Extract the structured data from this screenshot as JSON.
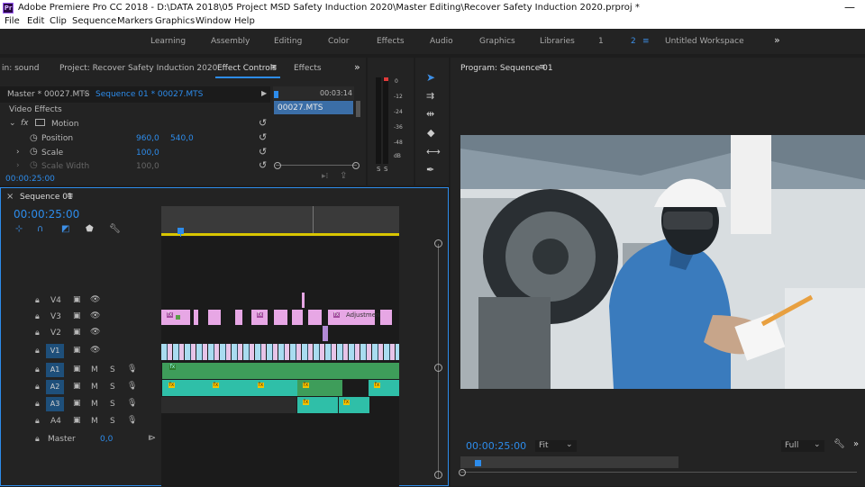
{
  "app": {
    "title": "Adobe Premiere Pro CC 2018 - D:\\DATA 2018\\05 Project MSD Safety Induction 2020\\Master Editing\\Recover Safety Induction 2020.prproj *",
    "icon_label": "Pr",
    "minimize": "—"
  },
  "menu": [
    "File",
    "Edit",
    "Clip",
    "Sequence",
    "Markers",
    "Graphics",
    "Window",
    "Help"
  ],
  "workspaces": {
    "items": [
      "Learning",
      "Assembly",
      "Editing",
      "Color",
      "Effects",
      "Audio",
      "Graphics",
      "Libraries",
      "1",
      "2",
      "Untitled Workspace"
    ],
    "active_index": 9,
    "more": "»"
  },
  "source_panel": {
    "tabs": [
      "in: sound",
      "Project: Recover Safety Induction 2020",
      "Effect Controls",
      "Effects"
    ],
    "active_tab": "Effect Controls",
    "master_clip": "Master * 00027.MTS",
    "sequence_clip": "Sequence 01 * 00027.MTS",
    "ruler_time": "00:03:14",
    "clip_name": "00027.MTS",
    "video_effects_label": "Video Effects",
    "motion_label": "Motion",
    "fx_label": "fx",
    "properties": [
      {
        "name": "Position",
        "v1": "960,0",
        "v2": "540,0"
      },
      {
        "name": "Scale",
        "v1": "100,0",
        "v2": ""
      },
      {
        "name": "Scale Width",
        "v1": "100,0",
        "v2": ""
      }
    ],
    "timecode": "00:00:25:00"
  },
  "audio_meter": {
    "scale": [
      "0",
      "-12",
      "-24",
      "-36",
      "-48",
      "dB"
    ],
    "solo": [
      "S",
      "S"
    ]
  },
  "timeline": {
    "tab": "Sequence 01",
    "timecode": "00:00:25:00",
    "video_tracks": [
      "V4",
      "V3",
      "V2",
      "V1"
    ],
    "audio_tracks": [
      "A1",
      "A2",
      "A3",
      "A4"
    ],
    "master_label": "Master",
    "master_value": "0,0",
    "m_label": "M",
    "s_label": "S",
    "adjustment_label": "Adjustmen",
    "fx_label": "fx"
  },
  "program": {
    "title": "Program: Sequence 01",
    "timecode": "00:00:25:00",
    "fit": "Fit",
    "quality": "Full"
  },
  "colors": {
    "accent": "#2d8ceb",
    "video_clip": "#e7a7e5",
    "v1_clip": "#a9dcf0",
    "audio_clip": "#3e9d5a",
    "audio_clip_alt": "#2fbfa8"
  }
}
